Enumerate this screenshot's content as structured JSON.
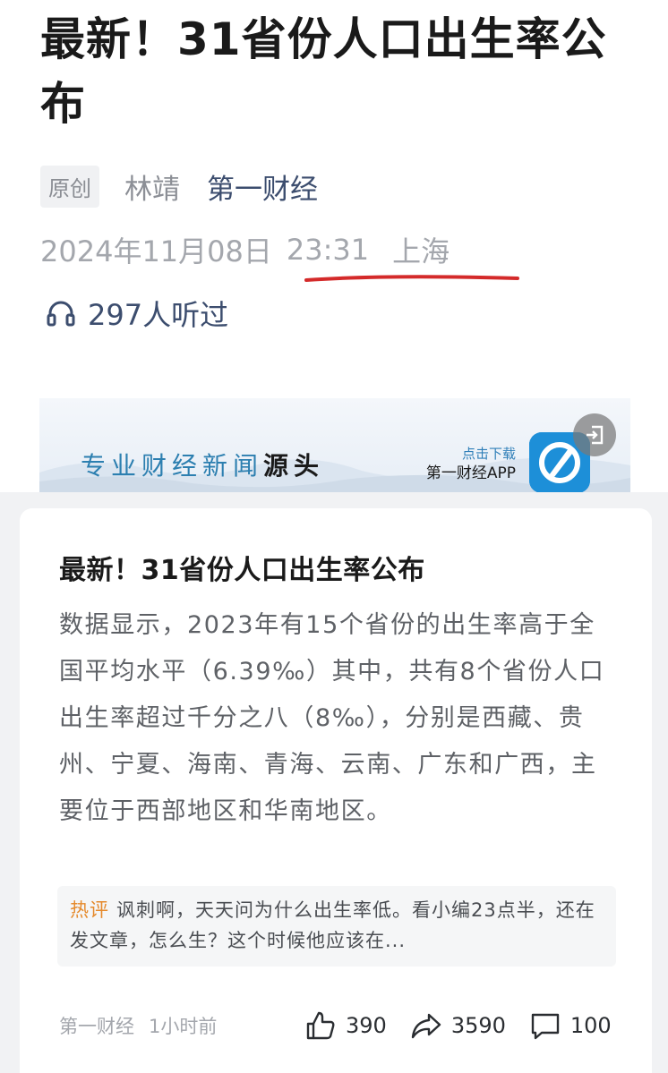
{
  "article": {
    "title": "最新！31省份人口出生率公布",
    "original_tag": "原创",
    "author": "林靖",
    "source": "第一财经",
    "date": "2024年11月08日",
    "time": "23:31",
    "location": "上海",
    "listen_count": "297人听过"
  },
  "banner": {
    "slogan_main": "专业财经新闻",
    "slogan_bold": "源头",
    "cta": "点击下载",
    "app_name": "第一财经APP"
  },
  "card": {
    "title": "最新！31省份人口出生率公布",
    "body": "数据显示，2023年有15个省份的出生率高于全国平均水平（6.39‰）其中，共有8个省份人口出生率超过千分之八（8‰），分别是西藏、贵州、宁夏、海南、青海、云南、广东和广西，主要位于西部地区和华南地区。",
    "hot_label": "热评",
    "hot_comment": "讽刺啊，天天问为什么出生率低。看小编23点半，还在发文章，怎么生？这个时候他应该在...",
    "footer_source": "第一财经",
    "footer_time": "1小时前",
    "likes": "390",
    "shares": "3590",
    "comments": "100"
  },
  "colors": {
    "accent_navy": "#3c4d6e",
    "hot_orange": "#e58a2c",
    "underline_red": "#d42a2a",
    "app_blue": "#1d8fd8"
  }
}
